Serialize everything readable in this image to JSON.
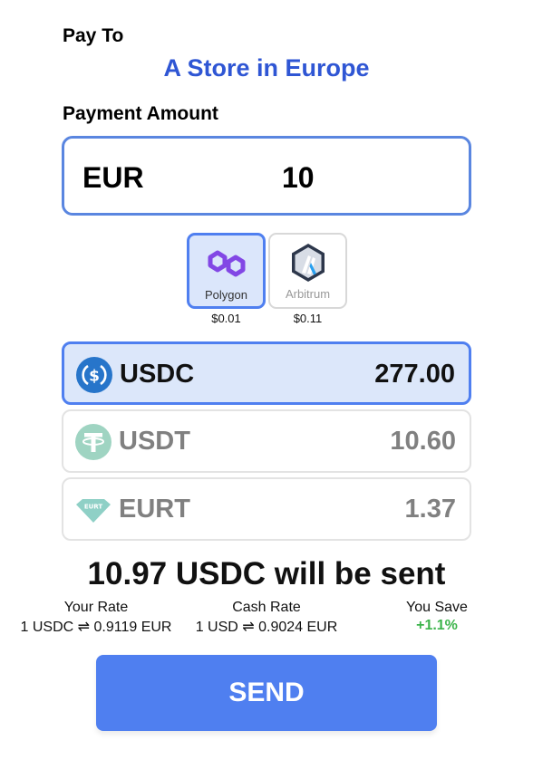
{
  "pay_to": {
    "label": "Pay To",
    "merchant": "A Store in Europe"
  },
  "payment": {
    "label": "Payment Amount",
    "currency": "EUR",
    "amount": "10"
  },
  "networks": [
    {
      "name": "Polygon",
      "fee": "$0.01",
      "selected": true,
      "icon": "polygon-icon"
    },
    {
      "name": "Arbitrum",
      "fee": "$0.11",
      "selected": false,
      "icon": "arbitrum-icon"
    }
  ],
  "tokens": [
    {
      "symbol": "USDC",
      "balance": "277.00",
      "selected": true,
      "icon": "usdc-icon"
    },
    {
      "symbol": "USDT",
      "balance": "10.60",
      "selected": false,
      "icon": "usdt-icon"
    },
    {
      "symbol": "EURT",
      "balance": "1.37",
      "selected": false,
      "icon": "eurt-icon"
    }
  ],
  "summary": {
    "amount": "10.97",
    "token": "USDC",
    "text": "will be sent"
  },
  "rates": {
    "your_rate_label": "Your Rate",
    "your_rate_value": "1 USDC ⇌ 0.9119 EUR",
    "cash_rate_label": "Cash Rate",
    "cash_rate_value": "1 USD ⇌ 0.9024 EUR",
    "save_label": "You Save",
    "save_value": "+1.1%"
  },
  "send_button": {
    "label": "SEND"
  },
  "colors": {
    "accent": "#4f7ff0",
    "merchant_text": "#2f56d4",
    "selected_bg": "#dce7fa",
    "savings": "#3cb44b"
  }
}
